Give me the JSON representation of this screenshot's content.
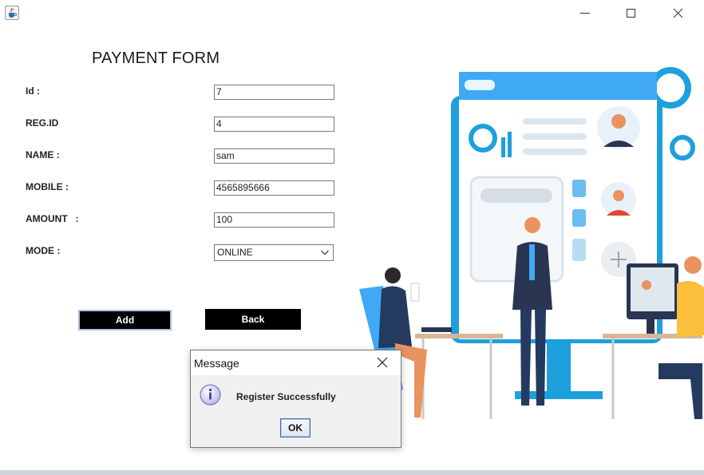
{
  "window": {
    "app_icon": "java-cup-icon",
    "controls": [
      "minimize-icon",
      "maximize-icon",
      "close-icon"
    ]
  },
  "form": {
    "title": "PAYMENT FORM",
    "fields": [
      {
        "label": "Id :",
        "value": "7"
      },
      {
        "label": "REG.ID",
        "value": "4"
      },
      {
        "label": "NAME :",
        "value": "sam"
      },
      {
        "label": "MOBILE :",
        "value": "4565895666"
      },
      {
        "label": "AMOUNT   :",
        "value": "100"
      }
    ],
    "mode": {
      "label": "MODE :",
      "selected": "ONLINE"
    },
    "buttons": {
      "add": "Add",
      "back": "Back"
    }
  },
  "dialog": {
    "title": "Message",
    "message": "Register Successfully",
    "ok_label": "OK",
    "icon": "info-icon"
  },
  "colors": {
    "button_bg": "#000000",
    "button_text": "#ffffff",
    "illustration_blue": "#1ea0dc",
    "illustration_light": "#e8f1fa"
  }
}
